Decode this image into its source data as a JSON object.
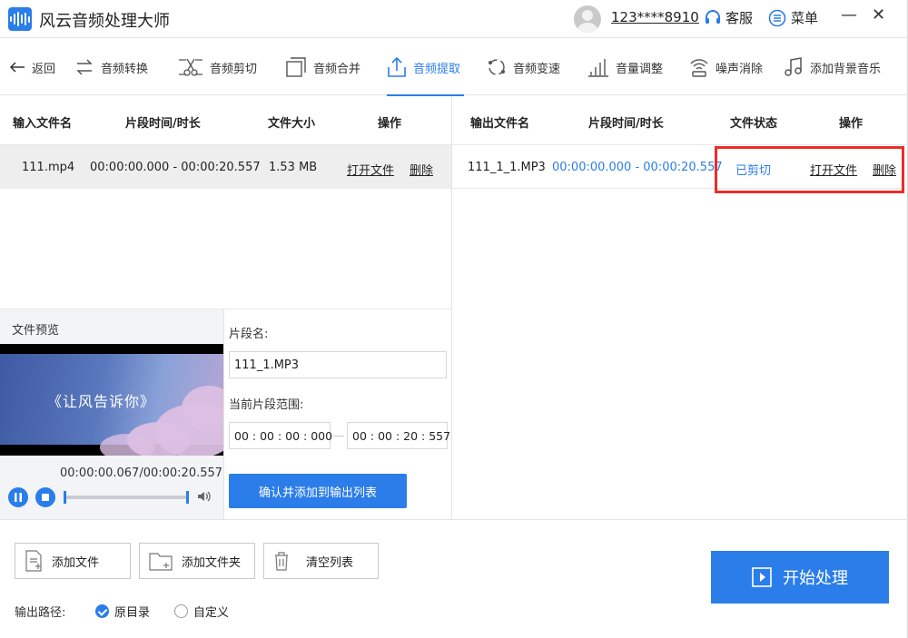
{
  "app": {
    "title": "风云音频处理大师",
    "user_phone": "123****8910",
    "service_label": "客服",
    "menu_label": "菜单"
  },
  "toolbar": {
    "back": "返回",
    "items": [
      {
        "label": "音频转换",
        "icon": "convert-icon"
      },
      {
        "label": "音频剪切",
        "icon": "scissors-icon"
      },
      {
        "label": "音频合并",
        "icon": "merge-icon"
      },
      {
        "label": "音频提取",
        "icon": "extract-icon",
        "active": true
      },
      {
        "label": "音频变速",
        "icon": "speed-icon"
      },
      {
        "label": "音量调整",
        "icon": "volume-bars-icon"
      },
      {
        "label": "噪声消除",
        "icon": "noise-icon"
      },
      {
        "label": "添加背景音乐",
        "icon": "music-note-icon"
      }
    ]
  },
  "input_table": {
    "headers": [
      "输入文件名",
      "片段时间/时长",
      "文件大小",
      "操作"
    ],
    "rows": [
      {
        "name": "111.mp4",
        "time": "00:00:00.000 - 00:00:20.557",
        "size": "1.53 MB",
        "open": "打开文件",
        "delete": "删除"
      }
    ]
  },
  "output_table": {
    "headers": [
      "输出文件名",
      "片段时间/时长",
      "文件状态",
      "操作"
    ],
    "rows": [
      {
        "name": "111_1_1.MP3",
        "time": "00:00:00.000 - 00:00:20.557",
        "status": "已剪切",
        "open": "打开文件",
        "delete": "删除"
      }
    ]
  },
  "preview": {
    "title": "文件预览",
    "caption": "《让风告诉你》",
    "time": "00:00:00.067/00:00:20.557",
    "progress": 0.003
  },
  "segment": {
    "name_label": "片段名:",
    "name_value": "111_1.MP3",
    "range_label": "当前片段范围:",
    "start": "00 : 00 : 00 : 000",
    "end": "00 : 00 : 20 : 557",
    "confirm": "确认并添加到输出列表"
  },
  "bottom": {
    "add_file": "添加文件",
    "add_folder": "添加文件夹",
    "clear_list": "清空列表",
    "output_path_label": "输出路径:",
    "opt_original": "原目录",
    "opt_custom": "自定义",
    "start": "开始处理"
  },
  "colors": {
    "accent": "#2b7de9",
    "highlight": "#ef2b2b"
  }
}
